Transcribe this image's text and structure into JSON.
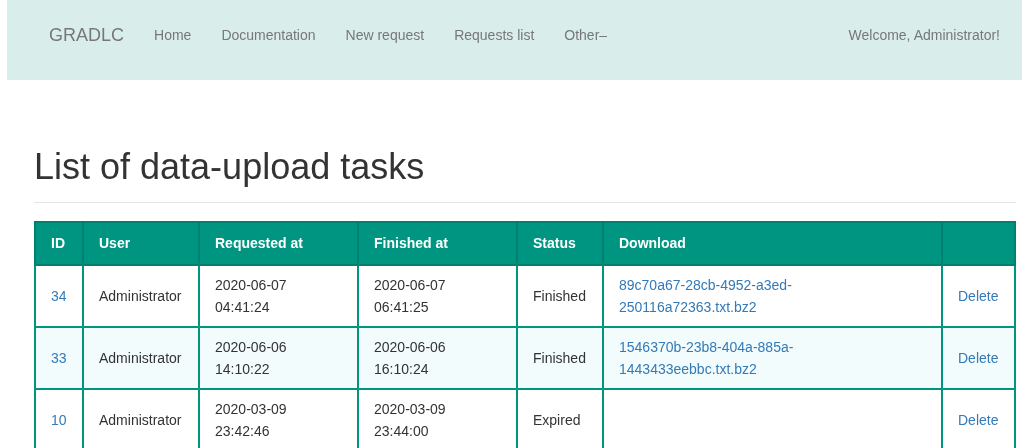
{
  "navbar": {
    "brand": "GRADLC",
    "items": [
      {
        "label": "Home"
      },
      {
        "label": "Documentation"
      },
      {
        "label": "New request"
      },
      {
        "label": "Requests list"
      },
      {
        "label": "Other",
        "caret": "–"
      }
    ],
    "welcome": "Welcome, Administrator!"
  },
  "heading": "List of data-upload tasks",
  "table": {
    "columns": [
      "ID",
      "User",
      "Requested at",
      "Finished at",
      "Status",
      "Download"
    ],
    "rows": [
      {
        "id": "34",
        "user": "Administrator",
        "requested": [
          "2020-06-07",
          "04:41:24"
        ],
        "finished": [
          "2020-06-07",
          "06:41:25"
        ],
        "status": "Finished",
        "download": [
          "89c70a67-28cb-4952-a3ed-",
          "250116a72363.txt.bz2"
        ],
        "action": "Delete"
      },
      {
        "id": "33",
        "user": "Administrator",
        "requested": [
          "2020-06-06",
          "14:10:22"
        ],
        "finished": [
          "2020-06-06",
          "16:10:24"
        ],
        "status": "Finished",
        "download": [
          "1546370b-23b8-404a-885a-",
          "1443433eebbc.txt.bz2"
        ],
        "action": "Delete"
      },
      {
        "id": "10",
        "user": "Administrator",
        "requested": [
          "2020-03-09",
          "23:42:46"
        ],
        "finished": [
          "2020-03-09",
          "23:44:00"
        ],
        "status": "Expired",
        "action": "Delete"
      }
    ]
  }
}
